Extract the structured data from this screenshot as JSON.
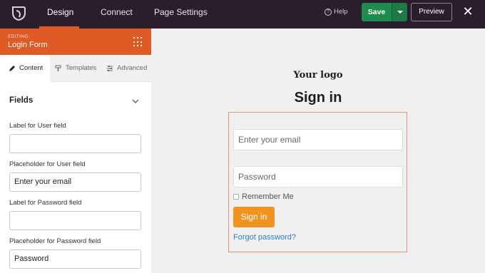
{
  "topbar": {
    "tabs": [
      {
        "label": "Design",
        "active": true
      },
      {
        "label": "Connect",
        "active": false
      },
      {
        "label": "Page Settings",
        "active": false
      }
    ],
    "help_label": "Help",
    "save_label": "Save",
    "preview_label": "Preview",
    "close_symbol": "✕",
    "accent_color": "#e05a25",
    "save_color": "#1f8c4f"
  },
  "sidebar": {
    "editing_small": "EDITING:",
    "editing_title": "Login Form",
    "tabs": [
      {
        "label": "Content",
        "icon": "pencil-icon",
        "active": true
      },
      {
        "label": "Templates",
        "icon": "brush-icon",
        "active": false
      },
      {
        "label": "Advanced",
        "icon": "sliders-icon",
        "active": false
      }
    ],
    "section_title": "Fields",
    "fields": [
      {
        "label": "Label for User field",
        "value": ""
      },
      {
        "label": "Placeholder for User field",
        "value": "Enter your email"
      },
      {
        "label": "Label for Password field",
        "value": ""
      },
      {
        "label": "Placeholder for Password field",
        "value": "Password"
      }
    ]
  },
  "canvas": {
    "logo_text": "Your logo",
    "heading": "Sign in",
    "email_placeholder": "Enter your email",
    "password_placeholder": "Password",
    "remember_label": "Remember Me",
    "signin_label": "Sign in",
    "forgot_label": "Forgot password?",
    "button_color": "#f0941f",
    "link_color": "#2f7fc2"
  }
}
